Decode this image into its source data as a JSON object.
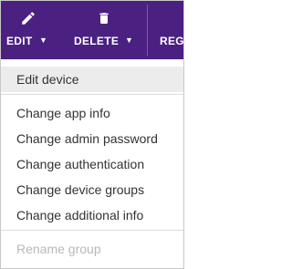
{
  "toolbar": {
    "background": "#4a2080",
    "edit": {
      "label": "EDIT",
      "icon": "pencil-icon",
      "caret": "▼"
    },
    "delete": {
      "label": "DELETE",
      "icon": "trash-icon",
      "caret": "▼"
    },
    "register": {
      "label": "REG",
      "icon": "chevron-down-icon"
    }
  },
  "menu": {
    "selected": "Edit device",
    "items": [
      "Edit device",
      "Change app info",
      "Change admin password",
      "Change authentication",
      "Change device groups",
      "Change additional info",
      "Rename group"
    ],
    "disabled": [
      "Rename group"
    ]
  }
}
